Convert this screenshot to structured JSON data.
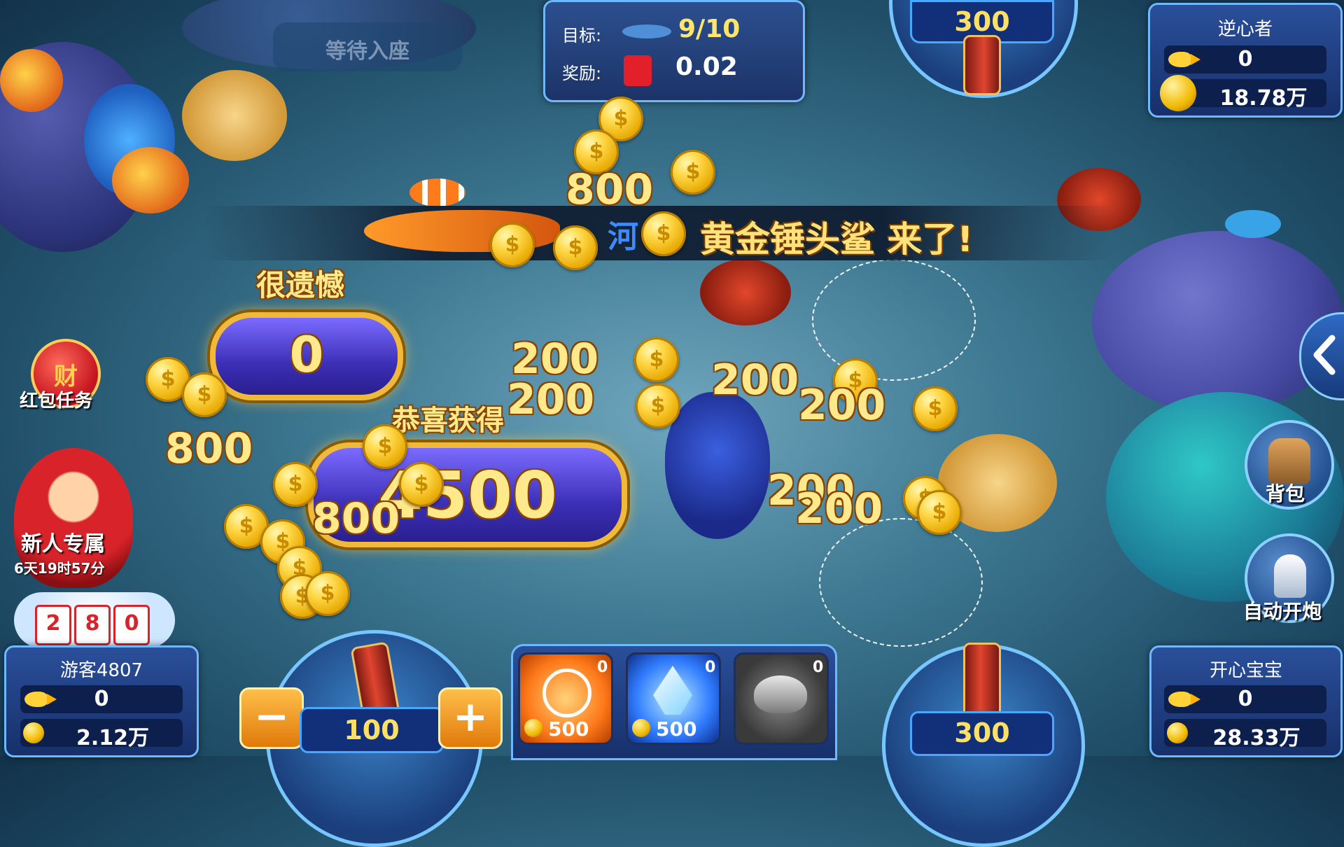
{
  "room": {
    "waiting_seat_label": "等待入座"
  },
  "target": {
    "goal_label": "目标:",
    "goal_progress": "9/10",
    "reward_label": "奖励:",
    "reward_value": "0.02"
  },
  "top_turret": {
    "bet": "300"
  },
  "players": {
    "top_right": {
      "name": "逆心者",
      "fish_count": "0",
      "coins": "18.78万"
    },
    "bottom_left": {
      "name": "游客4807",
      "fish_count": "0",
      "coins": "2.12万"
    },
    "bottom_right": {
      "name": "开心宝宝",
      "fish_count": "0",
      "coins": "28.33万"
    }
  },
  "announcement": {
    "text": "黄金锤头鲨 来了!",
    "prefix_partial": "河"
  },
  "results": {
    "regret_label": "很遗憾",
    "regret_value": "0",
    "congrats_label": "恭喜获得",
    "congrats_value": "4500"
  },
  "floating_scores": [
    "800",
    "800",
    "200",
    "200",
    "200",
    "200",
    "200",
    "200",
    "800"
  ],
  "left_menu": {
    "red_packet_label": "红包任务",
    "red_packet_icon_char": "财",
    "newbie_label": "新人专属",
    "newbie_timer": "6天19时57分",
    "slot_digits": [
      "2",
      "8",
      "0"
    ]
  },
  "right_menu": {
    "backpack_label": "背包",
    "auto_fire_label": "自动开炮",
    "collapse_icon": "chevron-left"
  },
  "my_turret": {
    "bet": "100",
    "minus": "−",
    "plus": "+"
  },
  "items": [
    {
      "name": "lock-target",
      "count": "0",
      "price": "500",
      "color": "#ff7a1a"
    },
    {
      "name": "freeze",
      "count": "0",
      "price": "500",
      "color": "#2f7bff"
    },
    {
      "name": "magic-lamp",
      "count": "0",
      "price": "",
      "color": "#5a5a5a"
    }
  ],
  "bottom_right_turret": {
    "bet": "300"
  }
}
